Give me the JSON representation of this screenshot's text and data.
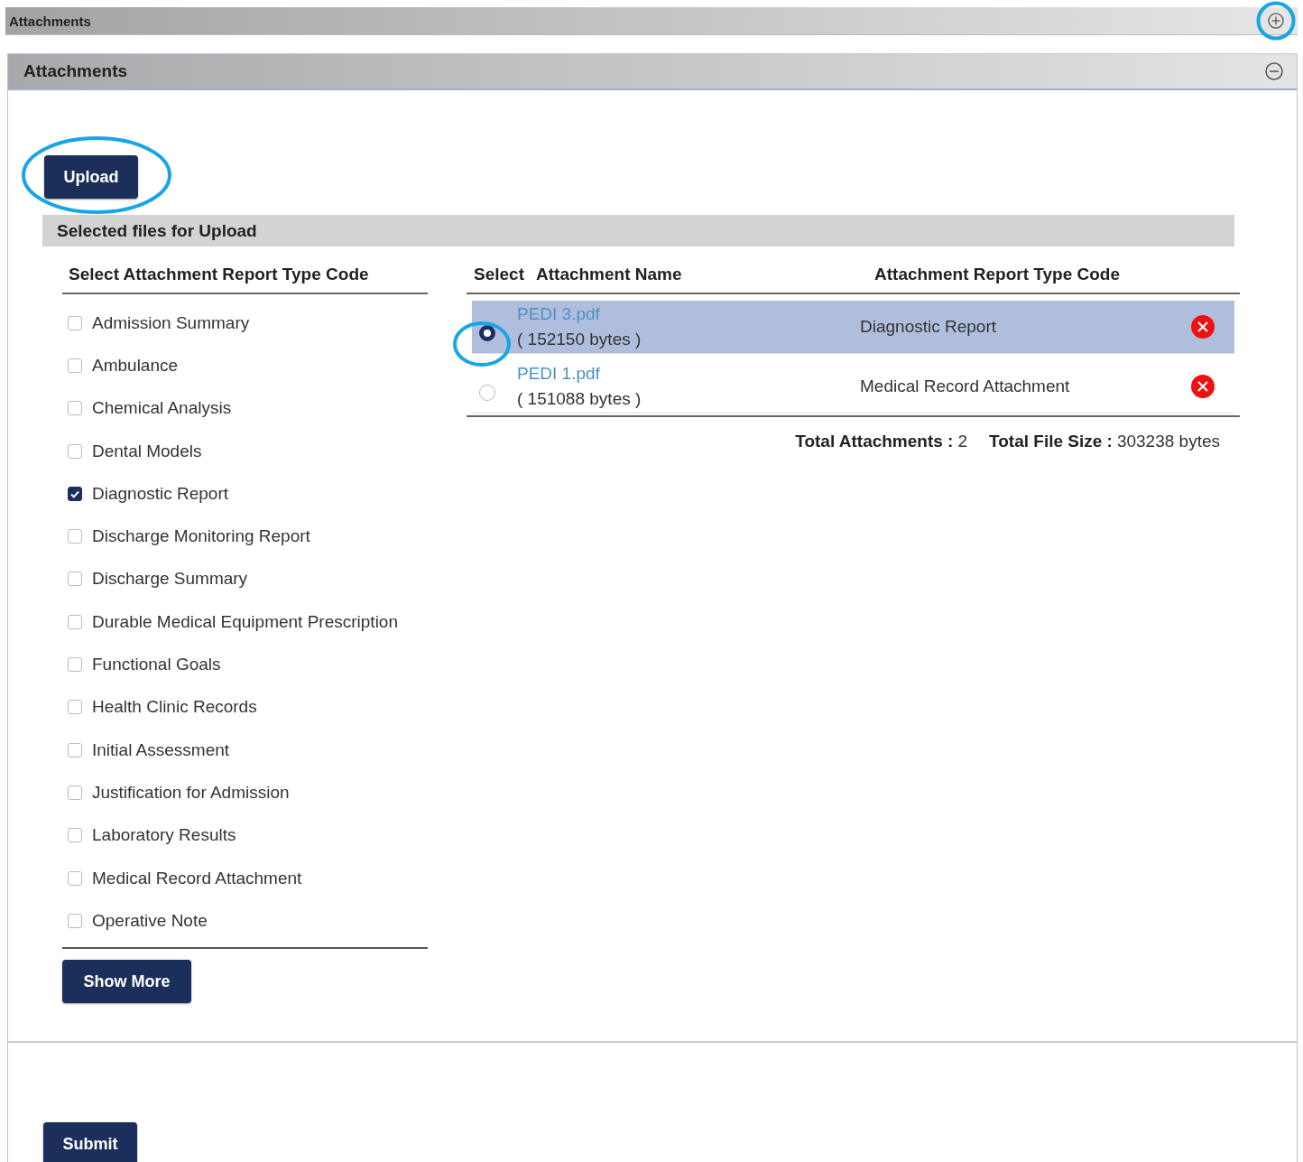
{
  "top_bar": {
    "title": "Attachments",
    "expand_highlighted": true
  },
  "panel": {
    "title": "Attachments",
    "upload_button": {
      "label": "Upload",
      "highlighted": true
    },
    "selected_files_title": "Selected files for Upload",
    "type_list": {
      "heading": "Select Attachment Report Type Code",
      "items": [
        {
          "label": "Admission Summary",
          "checked": false
        },
        {
          "label": "Ambulance",
          "checked": false
        },
        {
          "label": "Chemical Analysis",
          "checked": false
        },
        {
          "label": "Dental Models",
          "checked": false
        },
        {
          "label": "Diagnostic Report",
          "checked": true
        },
        {
          "label": "Discharge Monitoring Report",
          "checked": false
        },
        {
          "label": "Discharge Summary",
          "checked": false
        },
        {
          "label": "Durable Medical Equipment Prescription",
          "checked": false
        },
        {
          "label": "Functional Goals",
          "checked": false
        },
        {
          "label": "Health Clinic Records",
          "checked": false
        },
        {
          "label": "Initial Assessment",
          "checked": false
        },
        {
          "label": "Justification for Admission",
          "checked": false
        },
        {
          "label": "Laboratory Results",
          "checked": false
        },
        {
          "label": "Medical Record Attachment",
          "checked": false
        },
        {
          "label": "Operative Note",
          "checked": false
        }
      ],
      "show_more_label": "Show More"
    },
    "table": {
      "columns": [
        "Select",
        "Attachment Name",
        "Attachment Report Type Code"
      ],
      "rows": [
        {
          "selected": true,
          "highlighted": true,
          "file_name": "PEDI 3.pdf",
          "size": "( 152150 bytes )",
          "type_code": "Diagnostic Report"
        },
        {
          "selected": false,
          "highlighted": false,
          "file_name": "PEDI 1.pdf",
          "size": "( 151088 bytes )",
          "type_code": "Medical Record Attachment"
        }
      ]
    },
    "totals": [
      {
        "label": "Total Attachments :",
        "value": "2"
      },
      {
        "label": "Total File Size :",
        "value": "303238 bytes"
      }
    ],
    "submit_label": "Submit"
  }
}
